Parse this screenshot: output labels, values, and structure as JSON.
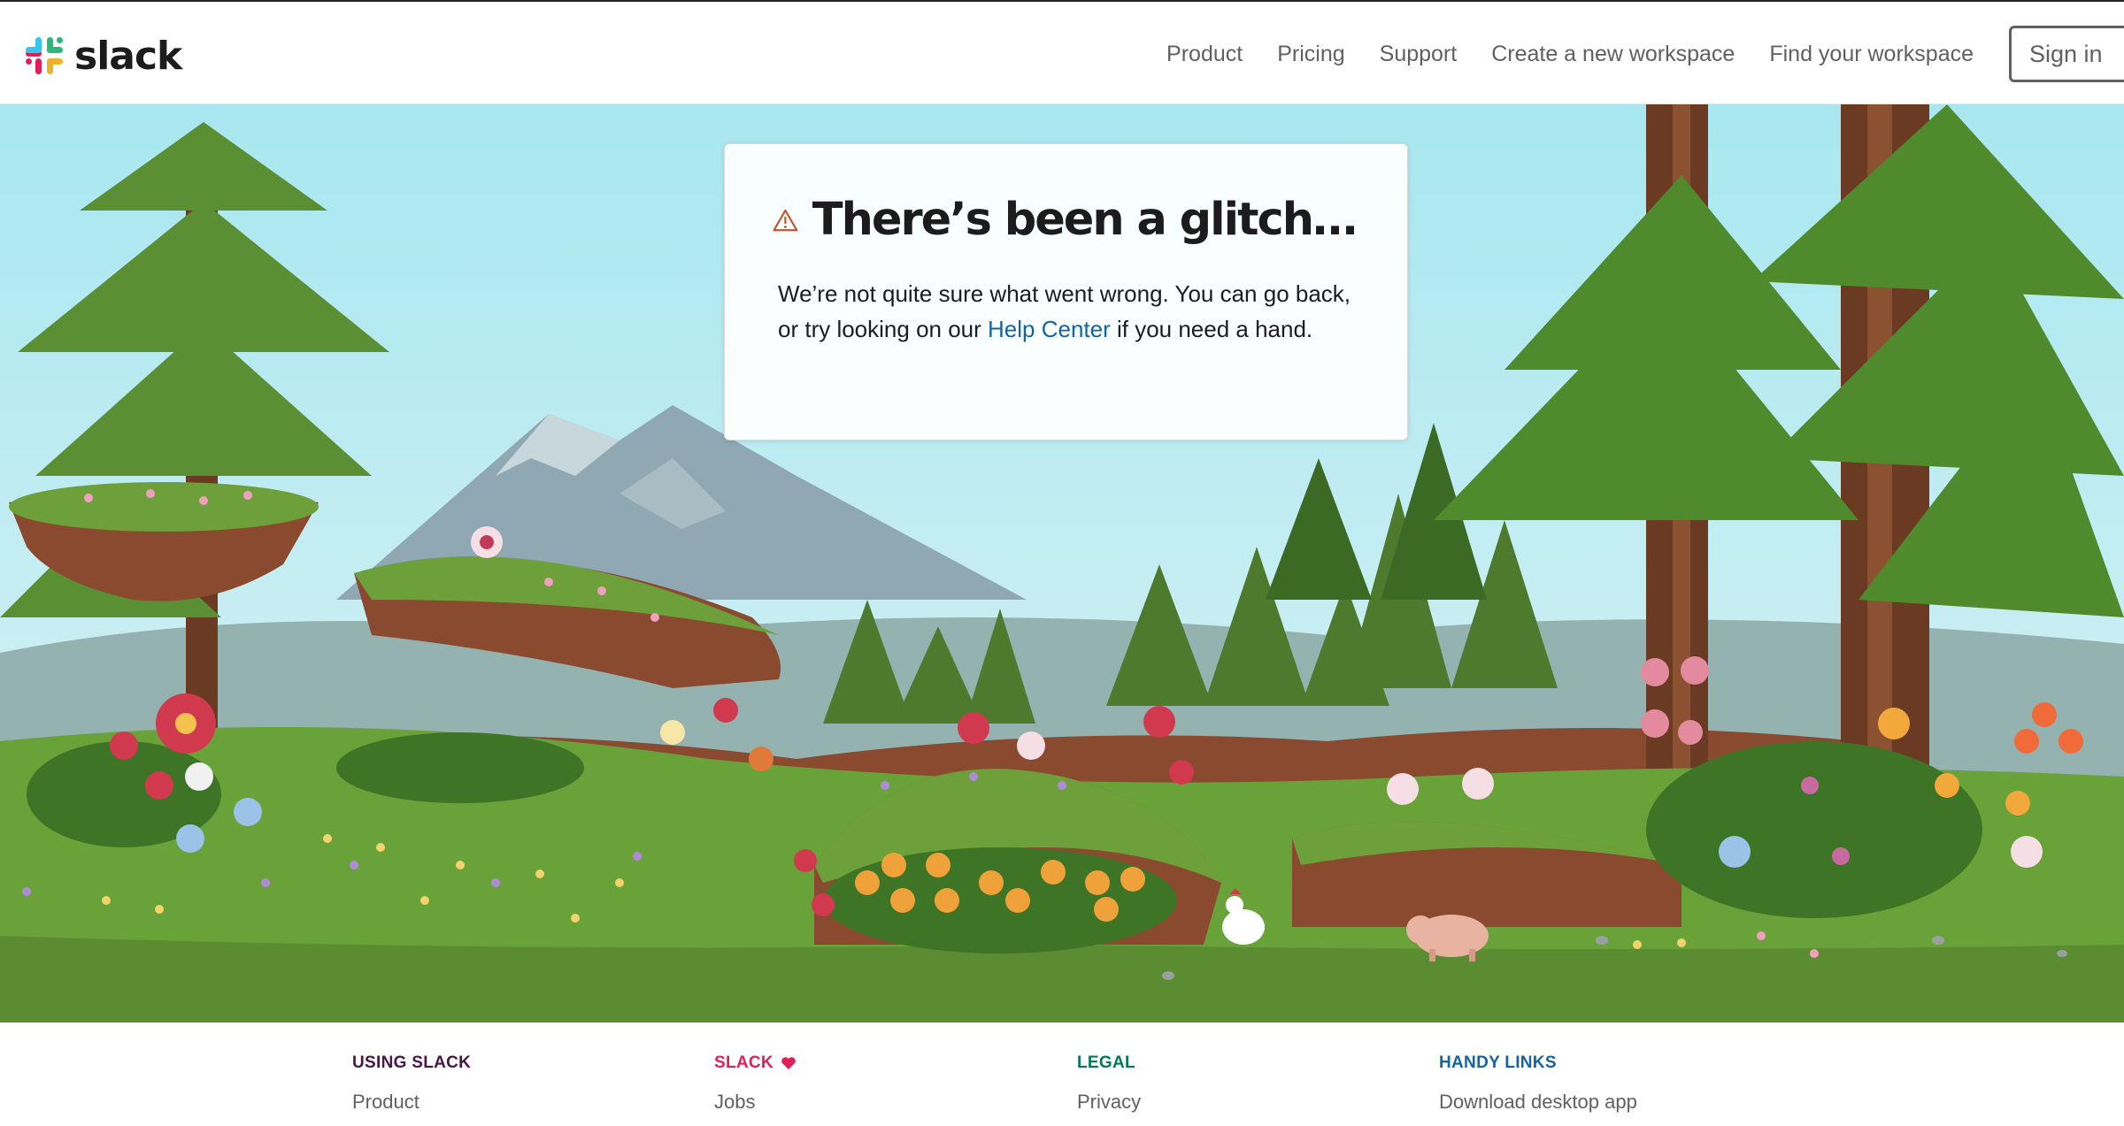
{
  "brand": {
    "name": "slack",
    "logo_icon": "slack-logo-icon"
  },
  "nav": {
    "items": [
      "Product",
      "Pricing",
      "Support",
      "Create a new workspace",
      "Find your workspace"
    ],
    "signin_label": "Sign in"
  },
  "error": {
    "icon": "warning-triangle-icon",
    "title": "There’s been a glitch…",
    "message_before": "We’re not quite sure what went wrong. You can go back, or try looking on our ",
    "link_text": "Help Center",
    "message_after": " if you need a hand."
  },
  "footer": {
    "columns": [
      {
        "heading": "USING SLACK",
        "color": "#4a154b",
        "link": "Product"
      },
      {
        "heading": "SLACK",
        "color": "#e01e5a",
        "heart_icon": "heart-icon",
        "link": "Jobs"
      },
      {
        "heading": "LEGAL",
        "color": "#007a5a",
        "link": "Privacy"
      },
      {
        "heading": "HANDY LINKS",
        "color": "#1264a3",
        "link": "Download desktop app"
      }
    ]
  },
  "colors": {
    "link": "#1264a3",
    "warning": "#c4532a",
    "nav_text": "#616061"
  }
}
